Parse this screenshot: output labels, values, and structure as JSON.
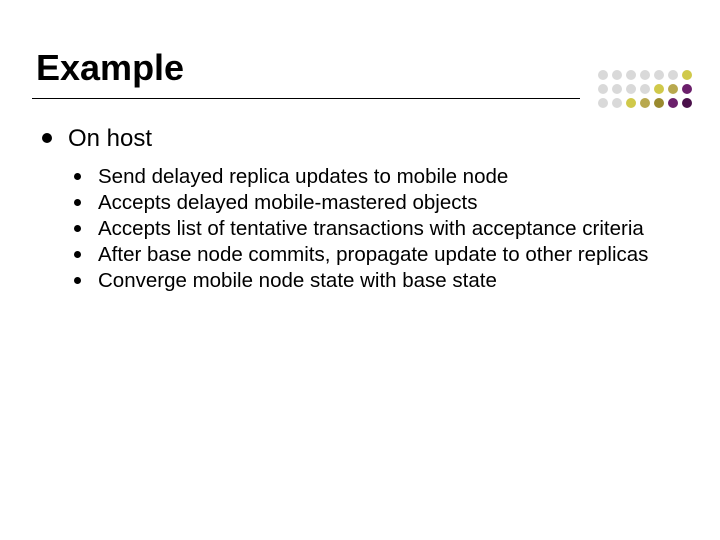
{
  "title": "Example",
  "level1_text": "On host",
  "level2": [
    "Send delayed replica updates to mobile node",
    "Accepts delayed mobile-mastered objects",
    "Accepts list of tentative transactions with acceptance criteria",
    "After base node commits, propagate update to other replicas",
    "Converge mobile node state with base state"
  ],
  "decoration": {
    "rows": [
      [
        "#d9d9d9",
        "#d9d9d9",
        "#d9d9d9",
        "#d9d9d9",
        "#d9d9d9",
        "#d9d9d9",
        "#d0c94a"
      ],
      [
        "#d9d9d9",
        "#d9d9d9",
        "#d9d9d9",
        "#d9d9d9",
        "#d0c94a",
        "#b8a84e",
        "#6b1f6b"
      ],
      [
        "#d9d9d9",
        "#d9d9d9",
        "#d0c94a",
        "#b8a84e",
        "#9a8a2e",
        "#6b1f6b",
        "#4a104a"
      ]
    ]
  }
}
